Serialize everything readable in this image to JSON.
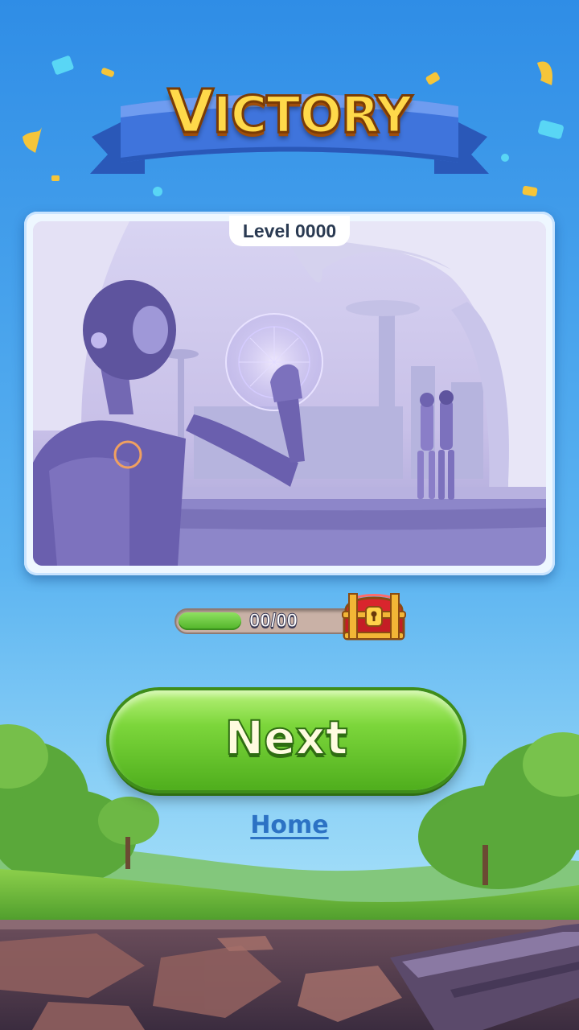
{
  "screen": {
    "title_main": "V",
    "title_rest": "ICTORY",
    "level_label": "Level 0000"
  },
  "progress": {
    "text": "00/00",
    "fill_fraction": 0.34
  },
  "actions": {
    "next_label": "Next",
    "home_label": "Home"
  },
  "colors": {
    "sky_top": "#2f8de6",
    "sky_bottom": "#8fd3f7",
    "banner_blue": "#3b6fd8",
    "title_gold": "#ffd94a",
    "button_green": "#7cd63b",
    "home_link": "#2c72c4"
  },
  "icons": {
    "chest": "treasure-chest-icon"
  }
}
